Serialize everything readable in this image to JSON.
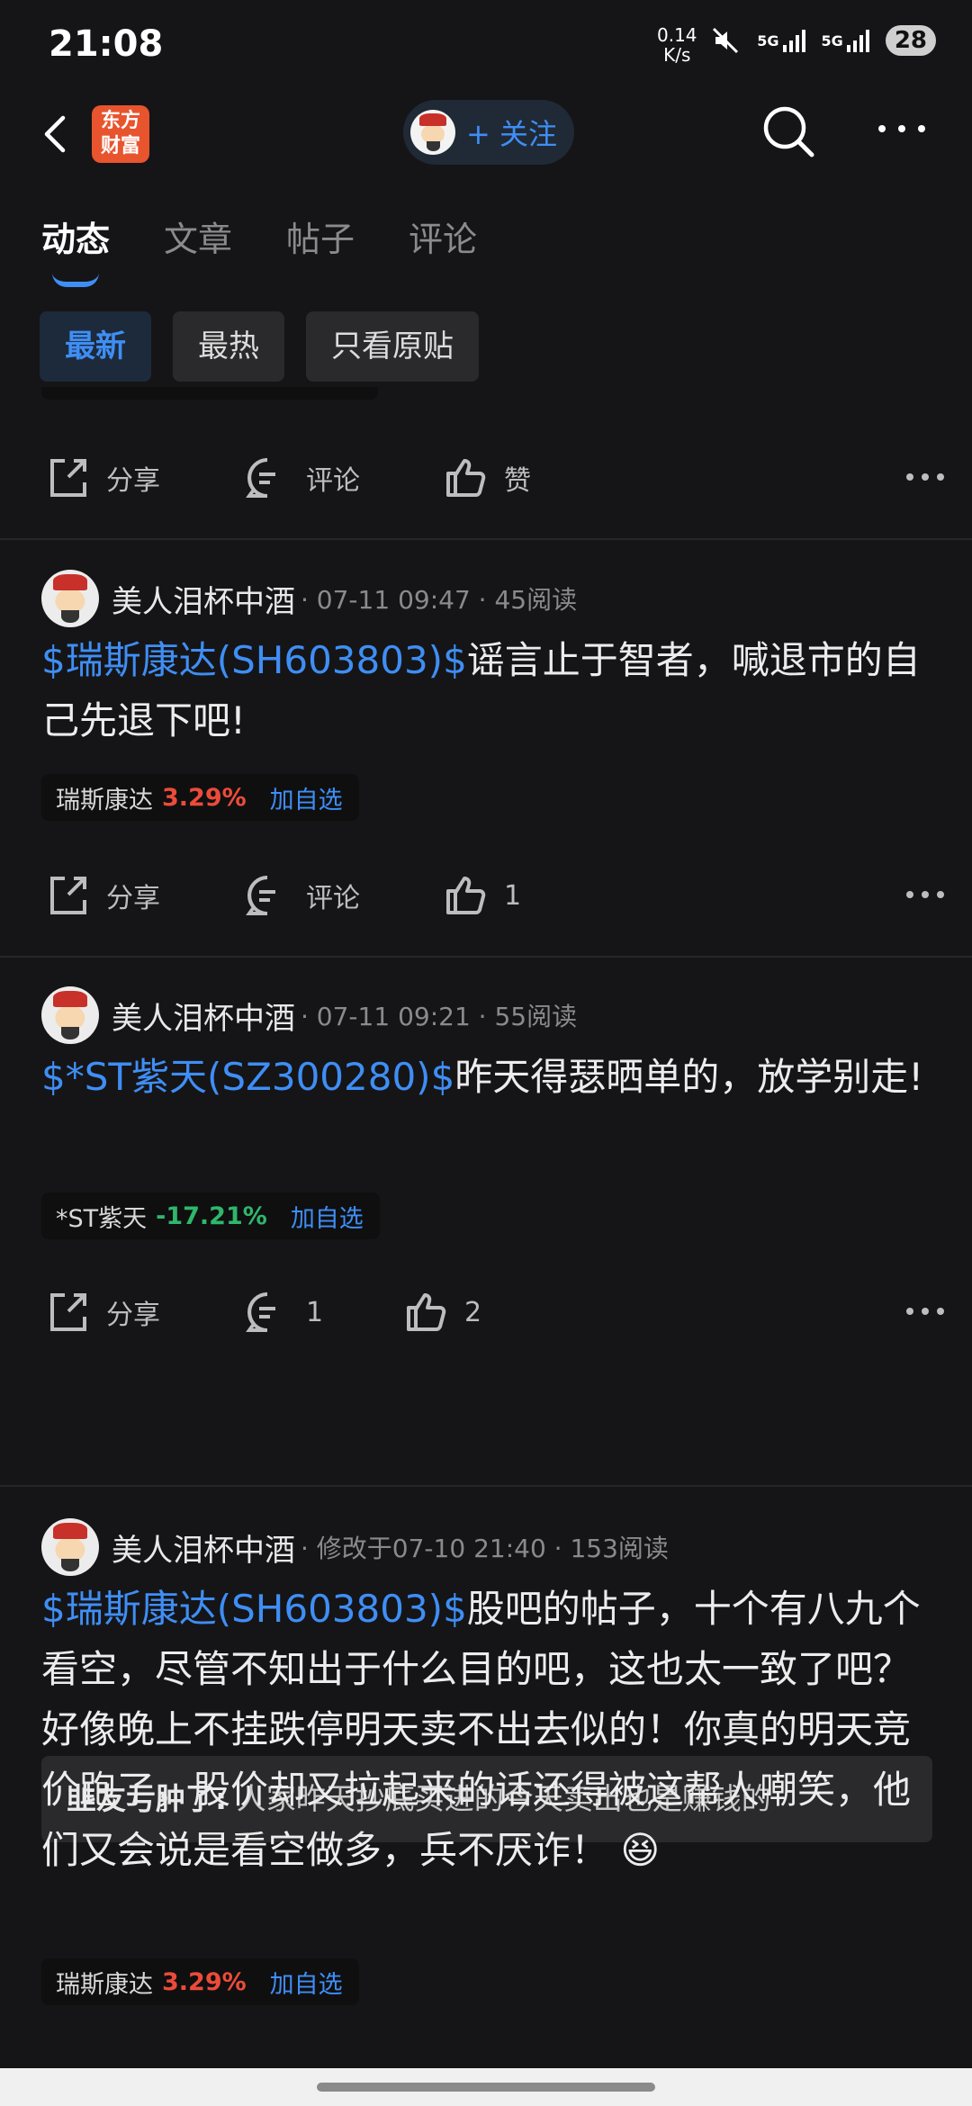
{
  "status_bar": {
    "time": "21:08",
    "net_speed_value": "0.14",
    "net_speed_unit": "K/s",
    "sim1": "5G",
    "sim2": "5G",
    "battery": "28"
  },
  "header": {
    "logo_line1": "东方",
    "logo_line2": "财富",
    "follow_label": "+ 关注"
  },
  "tabs": [
    {
      "label": "动态",
      "active": true
    },
    {
      "label": "文章",
      "active": false
    },
    {
      "label": "帖子",
      "active": false
    },
    {
      "label": "评论",
      "active": false
    }
  ],
  "filters": [
    {
      "label": "最新",
      "active": true
    },
    {
      "label": "最热",
      "active": false
    },
    {
      "label": "只看原贴",
      "active": false
    }
  ],
  "actions": {
    "share": "分享",
    "comment": "评论",
    "like": "赞"
  },
  "posts": [
    {
      "author": "美人泪杯中酒",
      "meta": "· 07-11 09:47 · 45阅读",
      "stock_link": "$瑞斯康达(SH603803)$",
      "text": "谣言止于智者，喊退市的自己先退下吧!",
      "tag_name": "瑞斯康达",
      "tag_change": "3.29%",
      "tag_add": "加自选",
      "share": "分享",
      "comment": "评论",
      "like": "1"
    },
    {
      "author": "美人泪杯中酒",
      "meta": "· 07-11 09:21 · 55阅读",
      "stock_link": "$*ST紫天(SZ300280)$",
      "text": "昨天得瑟晒单的，放学别走!",
      "tag_name": "*ST紫天",
      "tag_change": "-17.21%",
      "tag_add": "加自选",
      "share": "分享",
      "comment": "1",
      "like": "2",
      "reply_user": "韭友亏肿了:",
      "reply_text": "人家昨天抄底买进的今天卖出也是赚钱的"
    },
    {
      "author": "美人泪杯中酒",
      "meta": "· 修改于07-10 21:40 · 153阅读",
      "stock_link": "$瑞斯康达(SH603803)$",
      "text": "股吧的帖子，十个有八九个看空，尽管不知出于什么目的吧，这也太一致了吧？好像晚上不挂跌停明天卖不出去似的！你真的明天竞价跑了，股价却又拉起来的话还得被这帮人嘲笑，他们又会说是看空做多，兵不厌诈！",
      "emoji": "😆",
      "tag_name": "瑞斯康达",
      "tag_change": "3.29%",
      "tag_add": "加自选"
    }
  ],
  "colors": {
    "background": "#151517",
    "accent": "#3f8ef5",
    "up": "#ec4b3a",
    "down": "#2fb76c"
  }
}
